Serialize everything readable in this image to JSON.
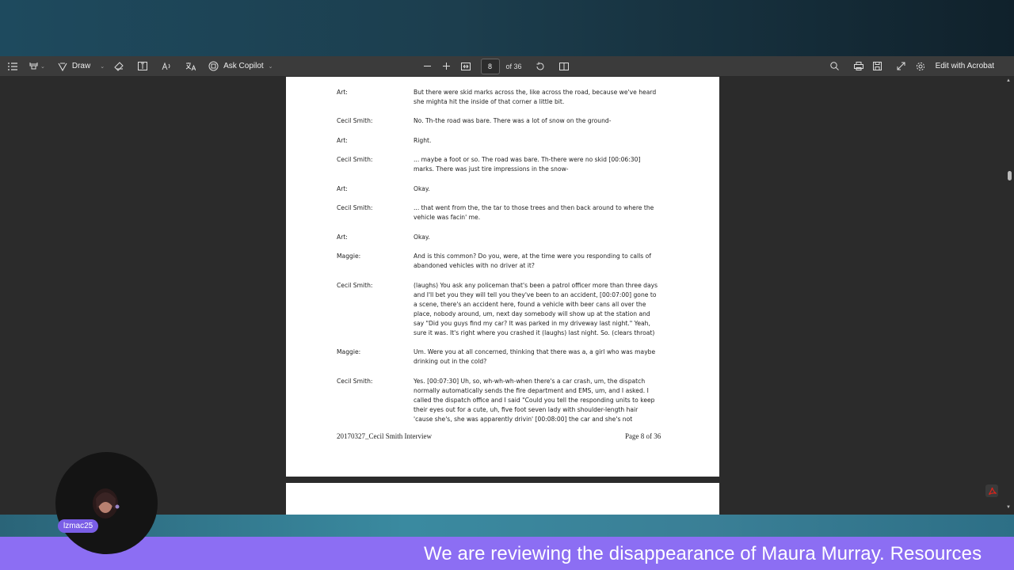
{
  "toolbar": {
    "draw_label": "Draw",
    "copilot_label": "Ask Copilot",
    "page_current": "8",
    "page_total": "of 36",
    "edit_label": "Edit with Acrobat"
  },
  "document": {
    "rows": [
      {
        "speaker": "Art:",
        "lines": [
          "But there were skid marks across the, like across the road, because we've heard",
          "she mighta hit the inside of that corner a little bit."
        ]
      },
      {
        "speaker": "Cecil Smith:",
        "lines": [
          "No. Th-the road was bare. There was a lot of snow on the ground-"
        ]
      },
      {
        "speaker": "Art:",
        "lines": [
          "Right."
        ]
      },
      {
        "speaker": "Cecil Smith:",
        "lines": [
          "... maybe a foot or so. The road was bare. Th-there were no skid [00:06:30]",
          "marks. There was just tire impressions in the snow-"
        ]
      },
      {
        "speaker": "Art:",
        "lines": [
          "Okay."
        ]
      },
      {
        "speaker": "Cecil Smith:",
        "lines": [
          "... that went from the, the tar to those trees and then back around to where the",
          "vehicle was facin' me."
        ]
      },
      {
        "speaker": "Art:",
        "lines": [
          "Okay."
        ]
      },
      {
        "speaker": "Maggie:",
        "lines": [
          "And is this common? Do you, were, at the time were you responding to calls of",
          "abandoned vehicles with no driver at it?"
        ]
      },
      {
        "speaker": "Cecil Smith:",
        "lines": [
          "(laughs) You ask any policeman that's been a patrol officer more than three days",
          "and I'll bet you they will tell you they've been to an accident, [00:07:00] gone to",
          "a scene, there's an accident here, found a vehicle with beer cans all over the",
          "place, nobody around, um, next day somebody will show up at the station and",
          "say \"Did you guys find my car? It was parked in my driveway last night.\" Yeah,",
          "sure it was. It's right where you crashed it (laughs) last night. So. (clears throat)"
        ]
      },
      {
        "speaker": "Maggie:",
        "lines": [
          "Um. Were you at all concerned, thinking that there was a, a girl who was maybe",
          "drinking out in the cold?"
        ]
      },
      {
        "speaker": "Cecil Smith:",
        "lines": [
          "Yes. [00:07:30] Uh, so, wh-wh-wh-when there's a car crash, um, the dispatch",
          "normally automatically sends the fire department and EMS, um, and I asked. I",
          "called the dispatch office and I said \"Could you tell the responding units to keep",
          "their eyes out for a cute, uh, five foot seven lady with shoulder-length hair",
          "'cause she's, she was apparently drivin' [00:08:00] the car and she's not"
        ]
      }
    ],
    "footer_left": "20170327_Cecil Smith Interview",
    "footer_right": "Page 8 of 36"
  },
  "stream": {
    "username": "lzmac25",
    "ticker": "We are reviewing the disappearance of Maura Murray. Resources"
  },
  "colors": {
    "toolbar_bg": "#3b3b3b",
    "viewer_bg": "#2b2b2b",
    "ticker_bg": "#8c6ef3",
    "user_pill_bg": "#7a5ee6"
  }
}
